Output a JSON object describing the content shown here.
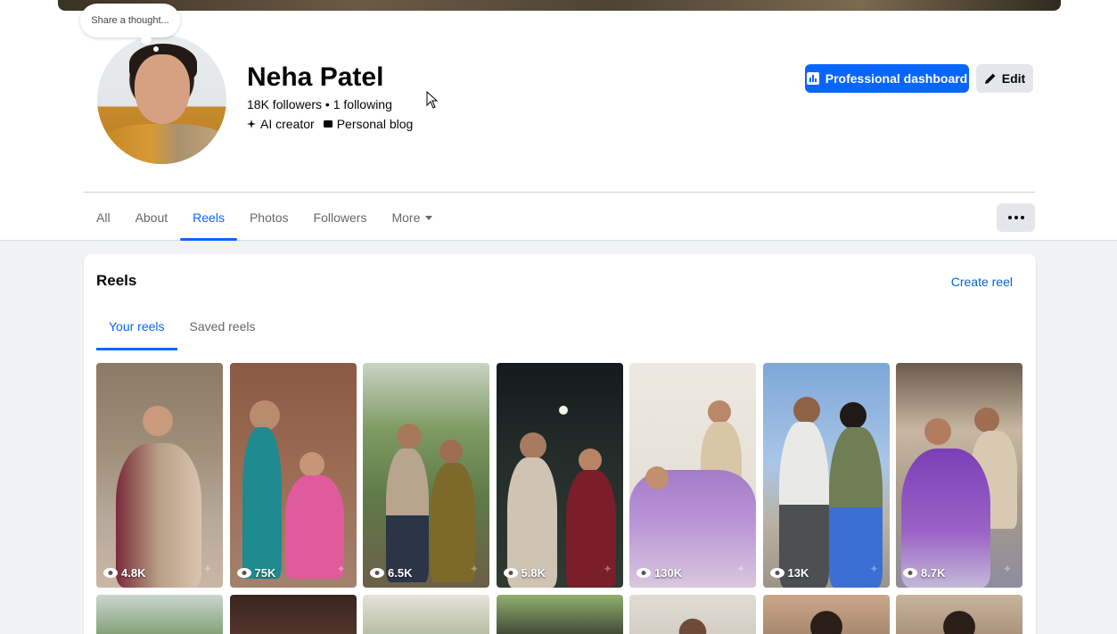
{
  "profile": {
    "name": "Neha Patel",
    "followers_line": "18K followers • 1 following",
    "tags": [
      {
        "icon": "sparkle-icon",
        "label": "AI creator"
      },
      {
        "icon": "blog-icon",
        "label": "Personal blog"
      }
    ],
    "thought_placeholder": "Share a thought..."
  },
  "actions": {
    "professional_dashboard": "Professional dashboard",
    "edit": "Edit"
  },
  "tabs": [
    "All",
    "About",
    "Reels",
    "Photos",
    "Followers",
    "More"
  ],
  "active_tab": "Reels",
  "reels_section": {
    "title": "Reels",
    "create_reel": "Create reel",
    "subtabs": [
      "Your reels",
      "Saved reels"
    ],
    "active_subtab": "Your reels",
    "reels": [
      {
        "views": "4.8K"
      },
      {
        "views": "75K"
      },
      {
        "views": "6.5K"
      },
      {
        "views": "5.8K"
      },
      {
        "views": "130K"
      },
      {
        "views": "13K"
      },
      {
        "views": "8.7K"
      }
    ]
  },
  "colors": {
    "accent": "#0866ff",
    "link": "#0064d1",
    "page_bg": "#f0f2f5"
  }
}
